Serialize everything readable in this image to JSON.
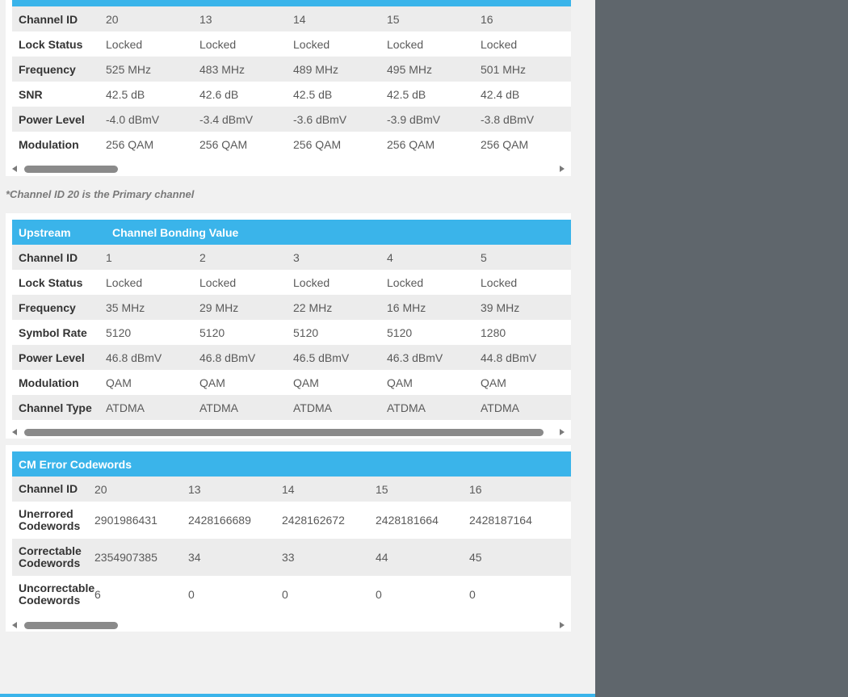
{
  "downstream": {
    "rows": [
      {
        "label": "Channel ID",
        "values": [
          "20",
          "13",
          "14",
          "15",
          "16"
        ]
      },
      {
        "label": "Lock Status",
        "values": [
          "Locked",
          "Locked",
          "Locked",
          "Locked",
          "Locked"
        ]
      },
      {
        "label": "Frequency",
        "values": [
          "525 MHz",
          "483 MHz",
          "489 MHz",
          "495 MHz",
          "501 MHz"
        ]
      },
      {
        "label": "SNR",
        "values": [
          "42.5 dB",
          "42.6 dB",
          "42.5 dB",
          "42.5 dB",
          "42.4 dB"
        ]
      },
      {
        "label": "Power Level",
        "values": [
          "-4.0 dBmV",
          "-3.4 dBmV",
          "-3.6 dBmV",
          "-3.9 dBmV",
          "-3.8 dBmV"
        ]
      },
      {
        "label": "Modulation",
        "values": [
          "256 QAM",
          "256 QAM",
          "256 QAM",
          "256 QAM",
          "256 QAM"
        ]
      }
    ]
  },
  "primary_note": "*Channel ID 20 is the Primary channel",
  "upstream": {
    "header_left": "Upstream",
    "header_right": "Channel Bonding Value",
    "rows": [
      {
        "label": "Channel ID",
        "values": [
          "1",
          "2",
          "3",
          "4",
          "5"
        ]
      },
      {
        "label": "Lock Status",
        "values": [
          "Locked",
          "Locked",
          "Locked",
          "Locked",
          "Locked"
        ]
      },
      {
        "label": "Frequency",
        "values": [
          "35 MHz",
          "29 MHz",
          "22 MHz",
          "16 MHz",
          "39 MHz"
        ]
      },
      {
        "label": "Symbol Rate",
        "values": [
          "5120",
          "5120",
          "5120",
          "5120",
          "1280"
        ]
      },
      {
        "label": "Power Level",
        "values": [
          "46.8 dBmV",
          "46.8 dBmV",
          "46.5 dBmV",
          "46.3 dBmV",
          "44.8 dBmV"
        ]
      },
      {
        "label": "Modulation",
        "values": [
          "QAM",
          "QAM",
          "QAM",
          "QAM",
          "QAM"
        ]
      },
      {
        "label": "Channel Type",
        "values": [
          "ATDMA",
          "ATDMA",
          "ATDMA",
          "ATDMA",
          "ATDMA"
        ]
      }
    ]
  },
  "errors": {
    "header": "CM Error Codewords",
    "rows": [
      {
        "label": "Channel ID",
        "values": [
          "20",
          "13",
          "14",
          "15",
          "16"
        ]
      },
      {
        "label": "Unerrored Codewords",
        "values": [
          "2901986431",
          "2428166689",
          "2428162672",
          "2428181664",
          "2428187164"
        ]
      },
      {
        "label": "Correctable Codewords",
        "values": [
          "2354907385",
          "34",
          "33",
          "44",
          "45"
        ]
      },
      {
        "label": "Uncorrectable Codewords",
        "values": [
          "6",
          "0",
          "0",
          "0",
          "0"
        ]
      }
    ]
  },
  "colors": {
    "accent": "#3ab4ea",
    "side_panel": "#5f666c"
  }
}
